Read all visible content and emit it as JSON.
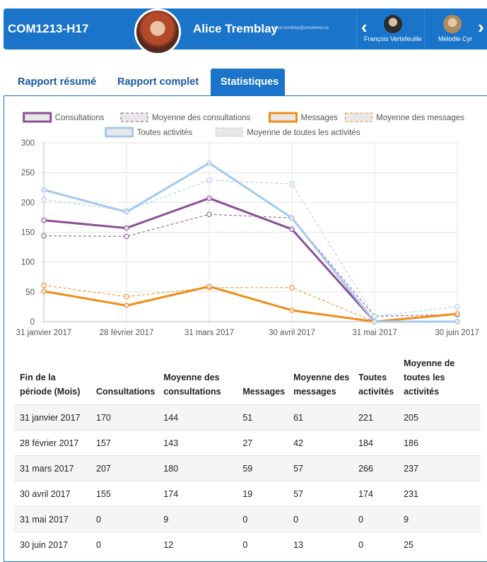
{
  "header": {
    "course_code": "COM1213-H17",
    "user_name": "Alice Tremblay",
    "user_email": "alice.tremblay@umontreal.ca",
    "peers": [
      {
        "name": "François Vertefeuille"
      },
      {
        "name": "Mélodie Cyr"
      }
    ]
  },
  "tabs": [
    {
      "label": "Rapport résumé",
      "active": false
    },
    {
      "label": "Rapport complet",
      "active": false
    },
    {
      "label": "Statistiques",
      "active": true
    }
  ],
  "chart_data": {
    "type": "line",
    "categories": [
      "31 janvier 2017",
      "28 février 2017",
      "31 mars 2017",
      "30 avril 2017",
      "31 mai 2017",
      "30 juin 2017"
    ],
    "ylim": [
      0,
      300
    ],
    "yticks": [
      0,
      50,
      100,
      150,
      200,
      250,
      300
    ],
    "grid": true,
    "legend": "top",
    "series": [
      {
        "name": "Consultations",
        "values": [
          170,
          157,
          207,
          155,
          0,
          0
        ],
        "color": "#8c4f96",
        "dashed": false
      },
      {
        "name": "Moyenne des consultations",
        "values": [
          144,
          143,
          180,
          174,
          9,
          12
        ],
        "color": "#8c4f96",
        "dashed": true
      },
      {
        "name": "Messages",
        "values": [
          51,
          27,
          59,
          19,
          0,
          13
        ],
        "color": "#f08c16",
        "dashed": false
      },
      {
        "name": "Moyenne des messages",
        "values": [
          61,
          42,
          57,
          57,
          0,
          13
        ],
        "color": "#f08c16",
        "dashed": true
      },
      {
        "name": "Toutes activités",
        "values": [
          221,
          184,
          266,
          174,
          0,
          0
        ],
        "color": "#a4c9ef",
        "dashed": false
      },
      {
        "name": "Moyenne de toutes les activités",
        "values": [
          205,
          186,
          237,
          231,
          9,
          25
        ],
        "color": "#a4c9ef",
        "dashed": true
      }
    ]
  },
  "table": {
    "headers": [
      "Fin de la période (Mois)",
      "Consultations",
      "Moyenne des consultations",
      "Messages",
      "Moyenne des messages",
      "Toutes activités",
      "Moyenne de toutes les activités"
    ],
    "rows": [
      [
        "31 janvier 2017",
        "170",
        "144",
        "51",
        "61",
        "221",
        "205"
      ],
      [
        "28 février 2017",
        "157",
        "143",
        "27",
        "42",
        "184",
        "186"
      ],
      [
        "31 mars 2017",
        "207",
        "180",
        "59",
        "57",
        "266",
        "237"
      ],
      [
        "30 avril 2017",
        "155",
        "174",
        "19",
        "57",
        "174",
        "231"
      ],
      [
        "31 mai 2017",
        "0",
        "9",
        "0",
        "0",
        "0",
        "9"
      ],
      [
        "30 juin 2017",
        "0",
        "12",
        "0",
        "13",
        "0",
        "25"
      ]
    ]
  }
}
